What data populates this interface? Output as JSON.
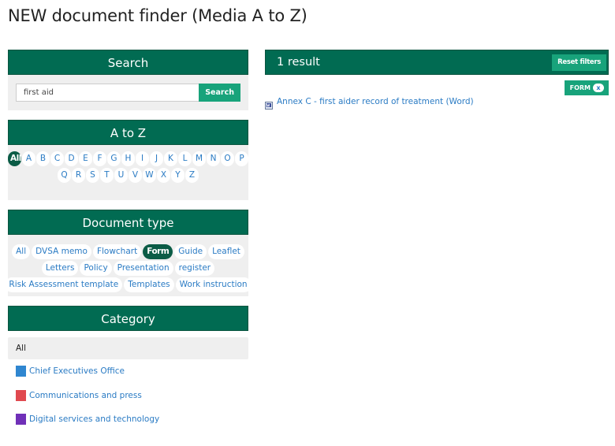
{
  "page": {
    "title": "NEW document finder (Media A to Z)"
  },
  "search": {
    "header": "Search",
    "value": "first aid",
    "placeholder": "",
    "button_label": "Search"
  },
  "az": {
    "header": "A to Z",
    "selected": "All",
    "row1": [
      "All",
      "A",
      "B",
      "C",
      "D",
      "E",
      "F",
      "G",
      "H",
      "I",
      "J",
      "K",
      "L",
      "M",
      "N",
      "O",
      "P"
    ],
    "row2": [
      "Q",
      "R",
      "S",
      "T",
      "U",
      "V",
      "W",
      "X",
      "Y",
      "Z"
    ]
  },
  "doctype": {
    "header": "Document type",
    "selected": "Form",
    "rows": [
      [
        "All",
        "DVSA memo",
        "Flowchart",
        "Form",
        "Guide",
        "Leaflet"
      ],
      [
        "Letters",
        "Policy",
        "Presentation",
        "register"
      ],
      [
        "Risk Assessment template",
        "Templates",
        "Work instruction"
      ]
    ]
  },
  "category": {
    "header": "Category",
    "all_label": "All",
    "items": [
      {
        "label": "Chief Executives Office",
        "color": "#2f86d0"
      },
      {
        "label": "Communications and press",
        "color": "#e0494f"
      },
      {
        "label": "Digital services and technology",
        "color": "#7030b8"
      }
    ]
  },
  "results": {
    "count_label": "1 result",
    "reset_label": "Reset filters",
    "active_filters": [
      {
        "label": "FORM",
        "remove_icon": "x"
      }
    ],
    "items": [
      {
        "title": "Annex C - first aider record of treatment (Word)",
        "icon": "word-document-icon"
      }
    ]
  },
  "colors": {
    "header_green": "#016b52",
    "accent_green": "#18a37b",
    "link_blue": "#2a7bc4",
    "panel_bg": "#efefef"
  }
}
